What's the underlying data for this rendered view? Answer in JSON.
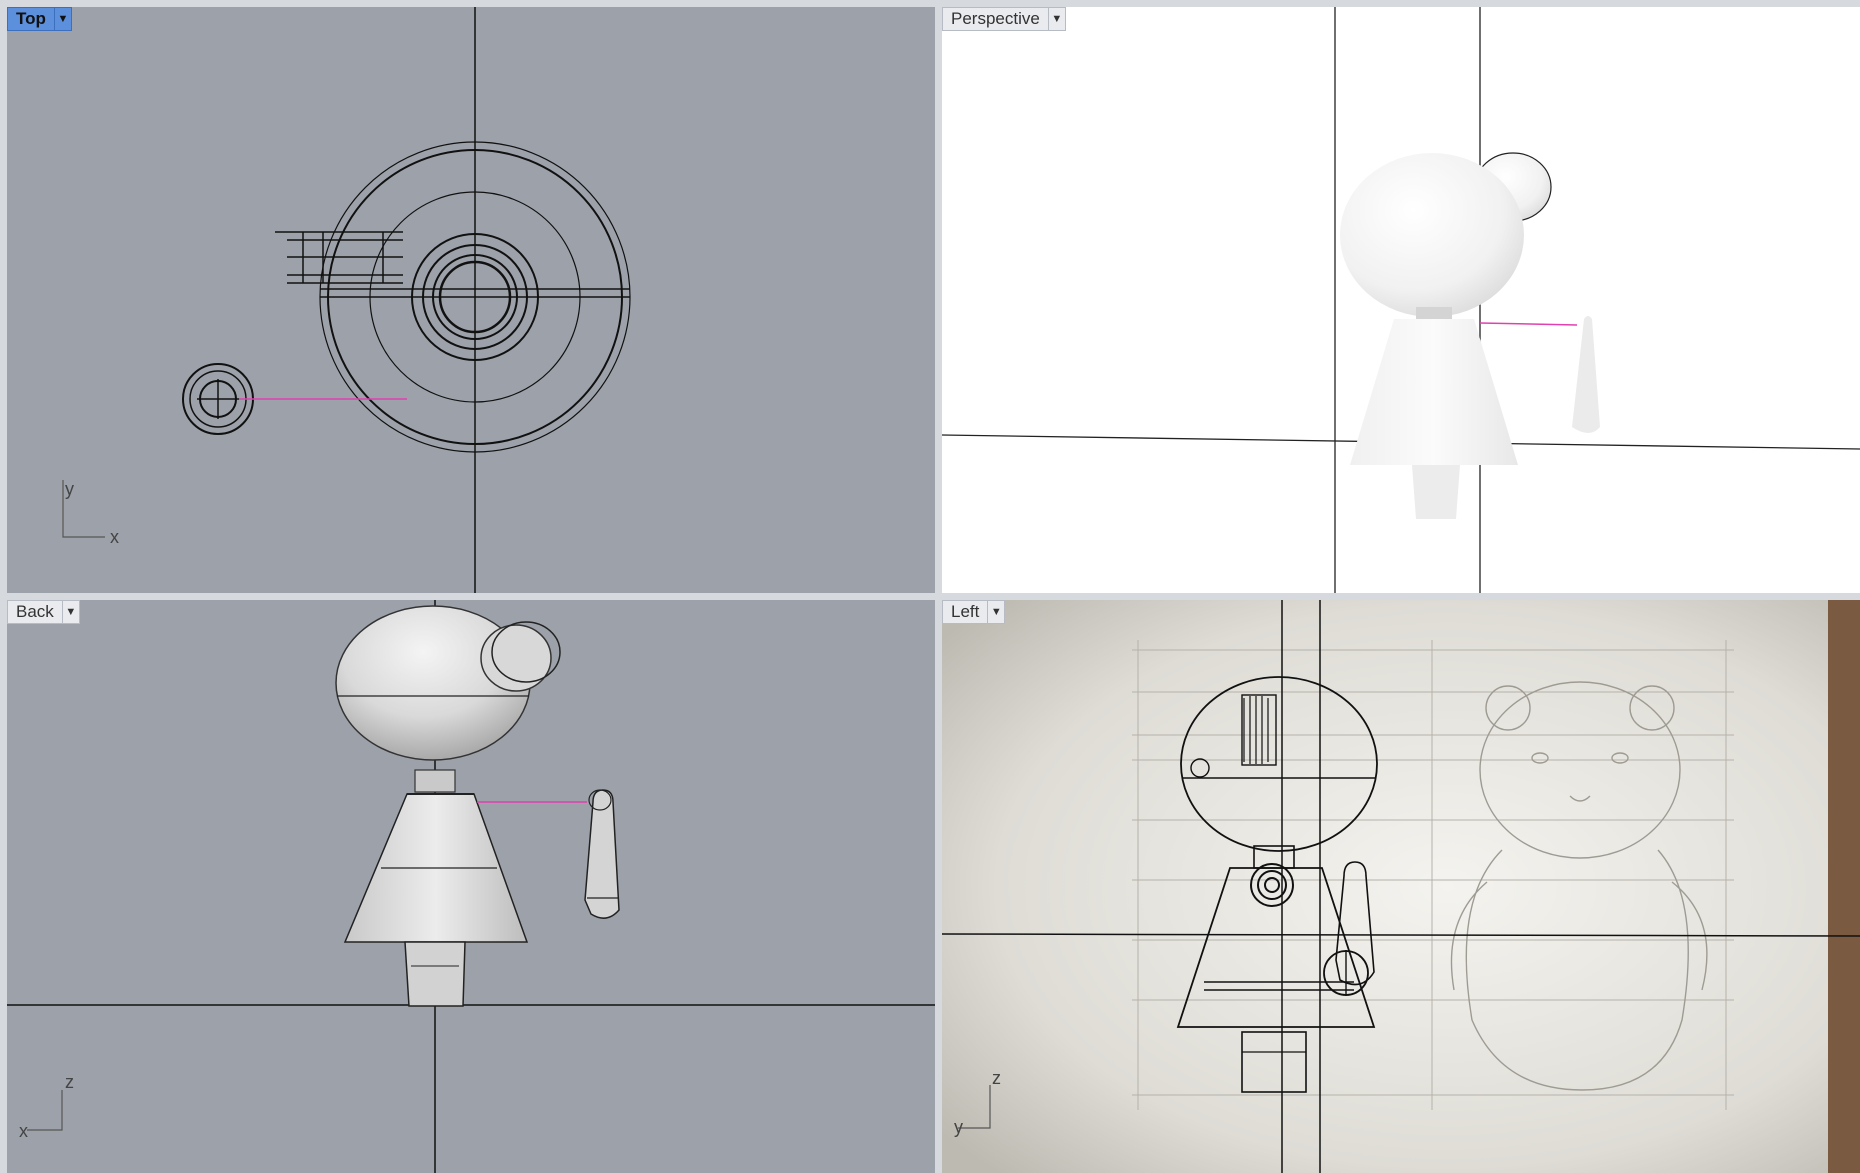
{
  "viewports": {
    "top": {
      "label": "Top",
      "active": true,
      "axes": {
        "a": "y",
        "b": "x"
      }
    },
    "perspective": {
      "label": "Perspective",
      "active": false
    },
    "back": {
      "label": "Back",
      "active": false,
      "axes": {
        "a": "z",
        "b": "x"
      }
    },
    "left": {
      "label": "Left",
      "active": false,
      "axes": {
        "a": "z",
        "b": "y"
      }
    }
  },
  "colors": {
    "viewport_gray": "#9da2aa",
    "active_tab": "#5c8fdc",
    "curve_selected": "#e040b0"
  },
  "icons": {
    "tab_menu": "chevron-down-icon"
  }
}
